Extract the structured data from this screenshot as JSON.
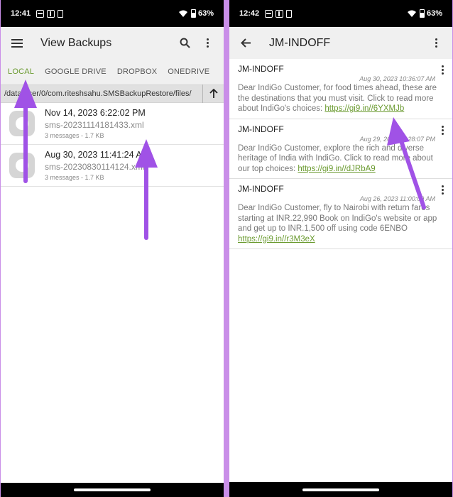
{
  "left": {
    "status": {
      "time": "12:41",
      "battery": "63%"
    },
    "appbar": {
      "title": "View Backups"
    },
    "tabs": [
      {
        "label": "LOCAL",
        "active": true
      },
      {
        "label": "GOOGLE DRIVE",
        "active": false
      },
      {
        "label": "DROPBOX",
        "active": false
      },
      {
        "label": "ONEDRIVE",
        "active": false
      }
    ],
    "path": "/data/user/0/com.riteshsahu.SMSBackupRestore/files/",
    "files": [
      {
        "date": "Nov 14, 2023 6:22:02 PM",
        "name": "sms-20231114181433.xml",
        "meta": "3 messages - 1.7 KB"
      },
      {
        "date": "Aug 30, 2023 11:41:24 AM",
        "name": "sms-20230830114124.xml",
        "meta": "3 messages - 1.7 KB"
      }
    ]
  },
  "right": {
    "status": {
      "time": "12:42",
      "battery": "63%"
    },
    "appbar": {
      "title": "JM-INDOFF"
    },
    "messages": [
      {
        "sender": "JM-INDOFF",
        "timestamp": "Aug 30, 2023 10:36:07 AM",
        "body": "Dear IndiGo Customer, for food times ahead, these are the destinations that you must visit. Click to read more about IndiGo's choices: ",
        "link": "https://gi9.in//6YXMJb"
      },
      {
        "sender": "JM-INDOFF",
        "timestamp": "Aug 29, 2023 11:28:07 PM",
        "body": "Dear IndiGo Customer, explore the rich and diverse heritage of India with IndiGo. Click to read more about our top choices: ",
        "link": "https://gi9.in//dJRbA9"
      },
      {
        "sender": "JM-INDOFF",
        "timestamp": "Aug 26, 2023 11:00:09 AM",
        "body": "Dear IndiGo Customer, fly to Nairobi with return fares starting at INR.22,990 Book on IndiGo's website or app and get up to INR.1,500 off using code 6ENBO ",
        "link": "https://gi9.in//r3M3eX"
      }
    ]
  },
  "colors": {
    "accent": "#6a9a2f",
    "annotation_arrow": "#a052e6",
    "background": "#c98ee8"
  }
}
